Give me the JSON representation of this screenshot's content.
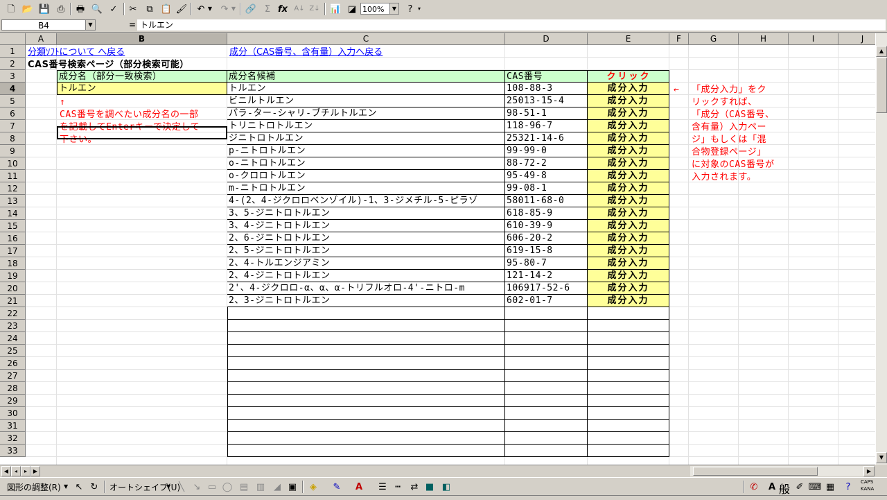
{
  "toolbar": {
    "zoom": "100%",
    "icons": [
      "new-icon",
      "open-icon",
      "save-icon",
      "permission-icon",
      "print-icon",
      "print-preview-icon",
      "spelling-icon",
      "cut-icon",
      "copy-icon",
      "paste-icon",
      "format-painter-icon",
      "undo-icon",
      "redo-icon",
      "hyperlink-icon",
      "autosum-icon",
      "function-icon",
      "sort-asc-icon",
      "sort-desc-icon",
      "chart-wizard-icon",
      "drawing-icon",
      "help-icon"
    ]
  },
  "formula_bar": {
    "name_box": "B4",
    "equals": "=",
    "content": "トルエン"
  },
  "columns": [
    "A",
    "B",
    "C",
    "D",
    "E",
    "F",
    "G",
    "H",
    "I",
    "J"
  ],
  "rows": [
    "1",
    "2",
    "3",
    "4",
    "5",
    "6",
    "7",
    "8",
    "9",
    "10",
    "11",
    "12",
    "13",
    "14",
    "15",
    "16",
    "17",
    "18",
    "19",
    "20",
    "21",
    "22",
    "23",
    "24",
    "25",
    "26",
    "27",
    "28",
    "29",
    "30",
    "31",
    "32",
    "33"
  ],
  "sheet": {
    "link_back_classification": "分類ｿﾌﾄについて へ戻る",
    "link_back_input": "成分（CAS番号、含有量）入力へ戻る",
    "page_title": "CAS番号検索ページ（部分検索可能）",
    "hdr_search": "成分名（部分一致検索）",
    "hdr_candidates": "成分名候補",
    "hdr_cas": "CAS番号",
    "hdr_click": "クリック",
    "search_value": "トルエン",
    "hint_arrow": "↑",
    "hint_lines": [
      "CAS番号を調べたい成分名の一部",
      "を記載してEnterキーで決定して",
      "下さい。"
    ],
    "note_arrow": "←",
    "note_lines": [
      "「成分入力」をク",
      "リックすれば、",
      "「成分（CAS番号、",
      "含有量）入力ペー",
      "ジ」もしくは「混",
      "合物登録ページ」",
      "に対象のCAS番号が",
      "入力されます。"
    ],
    "results": [
      {
        "name": "トルエン",
        "cas": "108-88-3",
        "btn": "成分入力"
      },
      {
        "name": "ビニルトルエン",
        "cas": "25013-15-4",
        "btn": "成分入力"
      },
      {
        "name": "パラ-ター-シャリ-ブチルトルエン",
        "cas": "98-51-1",
        "btn": "成分入力"
      },
      {
        "name": "トリニトロトルエン",
        "cas": "118-96-7",
        "btn": "成分入力"
      },
      {
        "name": "ジニトロトルエン",
        "cas": "25321-14-6",
        "btn": "成分入力"
      },
      {
        "name": "p-ニトロトルエン",
        "cas": "99-99-0",
        "btn": "成分入力"
      },
      {
        "name": "o-ニトロトルエン",
        "cas": "88-72-2",
        "btn": "成分入力"
      },
      {
        "name": "o-クロロトルエン",
        "cas": "95-49-8",
        "btn": "成分入力"
      },
      {
        "name": "m-ニトロトルエン",
        "cas": "99-08-1",
        "btn": "成分入力"
      },
      {
        "name": "4-(2、4-ジクロロベンゾイル)-1、3-ジメチル-5-ピラゾ",
        "cas": "58011-68-0",
        "btn": "成分入力"
      },
      {
        "name": "3、5-ジニトロトルエン",
        "cas": "618-85-9",
        "btn": "成分入力"
      },
      {
        "name": "3、4-ジニトロトルエン",
        "cas": "610-39-9",
        "btn": "成分入力"
      },
      {
        "name": "2、6-ジニトロトルエン",
        "cas": "606-20-2",
        "btn": "成分入力"
      },
      {
        "name": "2、5-ジニトロトルエン",
        "cas": "619-15-8",
        "btn": "成分入力"
      },
      {
        "name": "2、4-トルエンジアミン",
        "cas": "95-80-7",
        "btn": "成分入力"
      },
      {
        "name": "2、4-ジニトロトルエン",
        "cas": "121-14-2",
        "btn": "成分入力"
      },
      {
        "name": "2'、4-ジクロロ-α、α、α-トリフルオロ-4'-ニトロ-m",
        "cas": "106917-52-6",
        "btn": "成分入力"
      },
      {
        "name": "2、3-ジニトロトルエン",
        "cas": "602-01-7",
        "btn": "成分入力"
      }
    ]
  },
  "drawbar": {
    "draw_menu": "図形の調整(R)",
    "autoshape_menu": "オートシェイプ(U)",
    "ime_label": "般",
    "caps": "CAPS",
    "kana": "KANA"
  }
}
